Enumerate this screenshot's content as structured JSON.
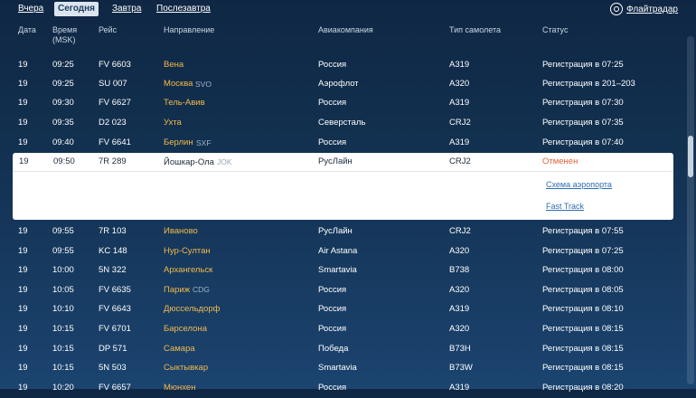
{
  "tabs": [
    {
      "label": "Вчера",
      "active": false
    },
    {
      "label": "Сегодня",
      "active": true
    },
    {
      "label": "Завтра",
      "active": false
    },
    {
      "label": "Послезавтра",
      "active": false
    }
  ],
  "brand": {
    "label": "Флайтрадар",
    "icon": "radar-icon"
  },
  "headers": {
    "date": "Дата",
    "time_line1": "Время",
    "time_line2": "(MSK)",
    "flight": "Рейс",
    "destination": "Направление",
    "airline": "Авиакомпания",
    "aircraft": "Тип самолета",
    "status": "Статус"
  },
  "rows_before": [
    {
      "date": "19",
      "time": "09:25",
      "flight": "FV 6603",
      "dest": "Вена",
      "iata": "",
      "airline": "Россия",
      "aircraft": "A319",
      "status": "Регистрация в 07:25"
    },
    {
      "date": "19",
      "time": "09:25",
      "flight": "SU 007",
      "dest": "Москва",
      "iata": "SVO",
      "airline": "Аэрофлот",
      "aircraft": "A320",
      "status": "Регистрация в 201–203"
    },
    {
      "date": "19",
      "time": "09:30",
      "flight": "FV 6627",
      "dest": "Тель-Авив",
      "iata": "",
      "airline": "Россия",
      "aircraft": "A319",
      "status": "Регистрация в 07:30"
    },
    {
      "date": "19",
      "time": "09:35",
      "flight": "D2 023",
      "dest": "Ухта",
      "iata": "",
      "airline": "Северсталь",
      "aircraft": "CRJ2",
      "status": "Регистрация в 07:35"
    },
    {
      "date": "19",
      "time": "09:40",
      "flight": "FV 6641",
      "dest": "Берлин",
      "iata": "SXF",
      "airline": "Россия",
      "aircraft": "A319",
      "status": "Регистрация в 07:40"
    }
  ],
  "selected": {
    "date": "19",
    "time": "09:50",
    "flight": "7R 289",
    "dest": "Йошкар-Ола",
    "iata": "JOK",
    "airline": "РусЛайн",
    "aircraft": "CRJ2",
    "status": "Отменен",
    "links": [
      "Схема аэропорта",
      "Fast Track"
    ]
  },
  "rows_after": [
    {
      "date": "19",
      "time": "09:55",
      "flight": "7R 103",
      "dest": "Иваново",
      "iata": "",
      "airline": "РусЛайн",
      "aircraft": "CRJ2",
      "status": "Регистрация в 07:55"
    },
    {
      "date": "19",
      "time": "09:55",
      "flight": "KC 148",
      "dest": "Нур-Султан",
      "iata": "",
      "airline": "Air Astana",
      "aircraft": "A320",
      "status": "Регистрация в 07:25"
    },
    {
      "date": "19",
      "time": "10:00",
      "flight": "5N 322",
      "dest": "Архангельск",
      "iata": "",
      "airline": "Smartavia",
      "aircraft": "B738",
      "status": "Регистрация в 08:00"
    },
    {
      "date": "19",
      "time": "10:05",
      "flight": "FV 6635",
      "dest": "Париж",
      "iata": "CDG",
      "airline": "Россия",
      "aircraft": "A320",
      "status": "Регистрация в 08:05"
    },
    {
      "date": "19",
      "time": "10:10",
      "flight": "FV 6643",
      "dest": "Дюссельдорф",
      "iata": "",
      "airline": "Россия",
      "aircraft": "A319",
      "status": "Регистрация в 08:10"
    },
    {
      "date": "19",
      "time": "10:15",
      "flight": "FV 6701",
      "dest": "Барселона",
      "iata": "",
      "airline": "Россия",
      "aircraft": "A320",
      "status": "Регистрация в 08:15"
    },
    {
      "date": "19",
      "time": "10:15",
      "flight": "DP 571",
      "dest": "Самара",
      "iata": "",
      "airline": "Победа",
      "aircraft": "B73H",
      "status": "Регистрация в 08:15"
    },
    {
      "date": "19",
      "time": "10:15",
      "flight": "5N 503",
      "dest": "Сыктывкар",
      "iata": "",
      "airline": "Smartavia",
      "aircraft": "B73W",
      "status": "Регистрация в 08:15"
    },
    {
      "date": "19",
      "time": "10:20",
      "flight": "FV 6657",
      "dest": "Мюнхен",
      "iata": "",
      "airline": "Россия",
      "aircraft": "A319",
      "status": "Регистрация в 08:20"
    }
  ]
}
